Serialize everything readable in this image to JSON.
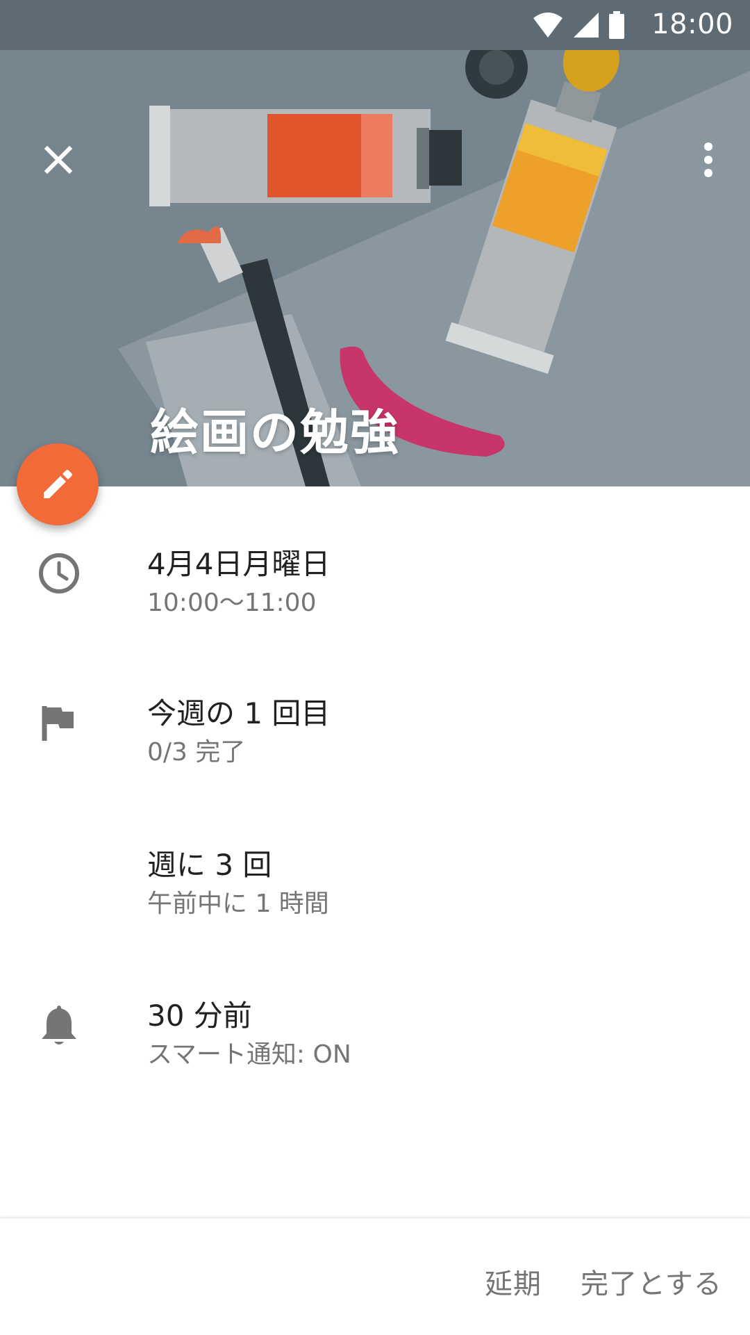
{
  "status_bar": {
    "time": "18:00"
  },
  "hero": {
    "title": "絵画の勉強",
    "background_color": "#7c8a93",
    "close_icon": "close-icon",
    "more_icon": "more-vert-icon"
  },
  "fab": {
    "icon": "edit-pencil-icon",
    "color": "#f26a38"
  },
  "details": [
    {
      "icon": "clock-icon",
      "primary": "4月4日月曜日",
      "secondary": "10:00〜11:00"
    },
    {
      "icon": "flag-icon",
      "primary": "今週の 1 回目",
      "secondary": "0/3 完了"
    },
    {
      "icon": "",
      "primary": "週に 3 回",
      "secondary": "午前中に 1 時間"
    },
    {
      "icon": "bell-icon",
      "primary": "30 分前",
      "secondary": "スマート通知: ON"
    }
  ],
  "actions": {
    "postpone": "延期",
    "complete": "完了とする"
  }
}
